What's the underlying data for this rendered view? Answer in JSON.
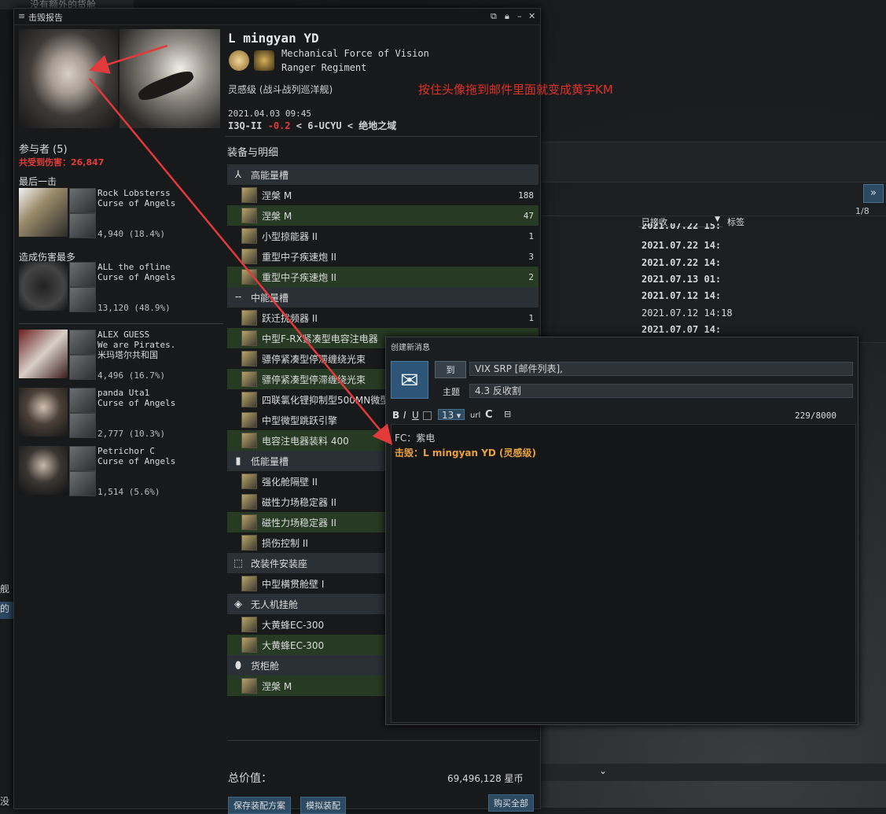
{
  "background": {
    "top_left_text": "没有额外的货舱",
    "page_indicator": "1/8",
    "col_received": "已接收",
    "col_tag": "标签",
    "dates": [
      "2021.07.22 15:",
      "2021.07.22 14:",
      "2021.07.22 14:",
      "2021.07.13 01:",
      "2021.07.12 14:",
      "2021.07.12 14:18",
      "2021.07.07 14:"
    ],
    "side_text_1": "舰",
    "side_text_2": "的",
    "bottom_left": "没"
  },
  "killmail": {
    "window_title": "击毁报告",
    "victim_name": "L mingyan YD",
    "corp": "Mechanical Force of Vision",
    "alliance": "Ranger Regiment",
    "ship": "灵感级",
    "ship_class": "(战斗战列巡洋舰)",
    "datetime": "2021.04.03 09:45",
    "system": "I3Q-II",
    "security": "-0.2",
    "constellation": "6-UCYU",
    "region": "绝地之域",
    "sep": "<",
    "participants_label": "参与者",
    "participants_count": "(5)",
    "damage_taken_label": "共受到伤害：26,847",
    "final_blow_label": "最后一击",
    "top_damage_label": "造成伤害最多",
    "attackers": [
      {
        "name": "Rock Lobsterss",
        "corp": "Curse of Angels",
        "extra": "",
        "dmg": "4,940 (18.4%)"
      },
      {
        "name": "ALL the ofline",
        "corp": "Curse of Angels",
        "extra": "",
        "dmg": "13,120 (48.9%)"
      },
      {
        "name": "ALEX GUESS",
        "corp": "We are Pirates.",
        "extra": "米玛塔尔共和国",
        "dmg": "4,496 (16.7%)"
      },
      {
        "name": "panda Uta1",
        "corp": "Curse of Angels",
        "extra": "",
        "dmg": "2,777 (10.3%)"
      },
      {
        "name": "Petrichor C",
        "corp": "Curse of Angels",
        "extra": "",
        "dmg": "1,514 (5.6%)"
      }
    ],
    "fitting_title": "装备与明细",
    "fitting": [
      {
        "type": "hdr",
        "icon": "⅄",
        "label": "高能量槽"
      },
      {
        "type": "item",
        "label": "涅槃 M",
        "qty": "188",
        "dropped": false
      },
      {
        "type": "item",
        "label": "涅槃 M",
        "qty": "47",
        "dropped": true
      },
      {
        "type": "item",
        "label": "小型掠能器 II",
        "qty": "1",
        "dropped": false
      },
      {
        "type": "item",
        "label": "重型中子疾速炮 II",
        "qty": "3",
        "dropped": false
      },
      {
        "type": "item",
        "label": "重型中子疾速炮 II",
        "qty": "2",
        "dropped": true
      },
      {
        "type": "hdr",
        "icon": "╌",
        "label": "中能量槽"
      },
      {
        "type": "item",
        "label": "跃迁扰频器 II",
        "qty": "1",
        "dropped": false
      },
      {
        "type": "item",
        "label": "中型F-RX紧凑型电容注电器",
        "qty": "",
        "dropped": true
      },
      {
        "type": "item",
        "label": "骠停紧凑型停滞缠绕光束",
        "qty": "",
        "dropped": false
      },
      {
        "type": "item",
        "label": "骠停紧凑型停滞缠绕光束",
        "qty": "",
        "dropped": true
      },
      {
        "type": "item",
        "label": "四联氯化锂抑制型500MN微型",
        "qty": "",
        "dropped": false
      },
      {
        "type": "item",
        "label": "中型微型跳跃引擎",
        "qty": "",
        "dropped": false
      },
      {
        "type": "item",
        "label": "电容注电器装料 400",
        "qty": "",
        "dropped": true
      },
      {
        "type": "hdr",
        "icon": "▮",
        "label": "低能量槽"
      },
      {
        "type": "item",
        "label": "强化舱隔壁 II",
        "qty": "",
        "dropped": false
      },
      {
        "type": "item",
        "label": "磁性力场稳定器 II",
        "qty": "",
        "dropped": false
      },
      {
        "type": "item",
        "label": "磁性力场稳定器 II",
        "qty": "",
        "dropped": true
      },
      {
        "type": "item",
        "label": "损伤控制 II",
        "qty": "",
        "dropped": false
      },
      {
        "type": "hdr",
        "icon": "⬚",
        "label": "改装件安装座"
      },
      {
        "type": "item",
        "label": "中型横贯舱壁 I",
        "qty": "",
        "dropped": false
      },
      {
        "type": "hdr",
        "icon": "◈",
        "label": "无人机挂舱"
      },
      {
        "type": "item",
        "label": "大黄蜂EC-300",
        "qty": "",
        "dropped": false
      },
      {
        "type": "item",
        "label": "大黄蜂EC-300",
        "qty": "",
        "dropped": true
      },
      {
        "type": "hdr",
        "icon": "⬮",
        "label": "货柜舱"
      },
      {
        "type": "item",
        "label": "涅槃 M",
        "qty": "",
        "dropped": true
      }
    ],
    "total_label": "总价值：",
    "total_value": "69,496,128 星币",
    "save_fit": "保存装配方案",
    "sim_fit": "模拟装配",
    "buy_all": "购买全部"
  },
  "annotation": "按住头像拖到邮件里面就变成黄字KM",
  "mail": {
    "title": "创建新消息",
    "to_label": "到",
    "to_value": "VIX SRP [邮件列表],",
    "subject_label": "主题",
    "subject_value": "4.3 反收割",
    "font_size": "13",
    "url": "url",
    "char_count": "229/8000",
    "body_line1": "FC：紫电",
    "body_line2": "击毁：L mingyan YD (灵感级)"
  },
  "colors": {
    "link_yellow": "#e8a23a",
    "arrow_red": "#e23a3a",
    "dropped_green": "#263a24"
  }
}
